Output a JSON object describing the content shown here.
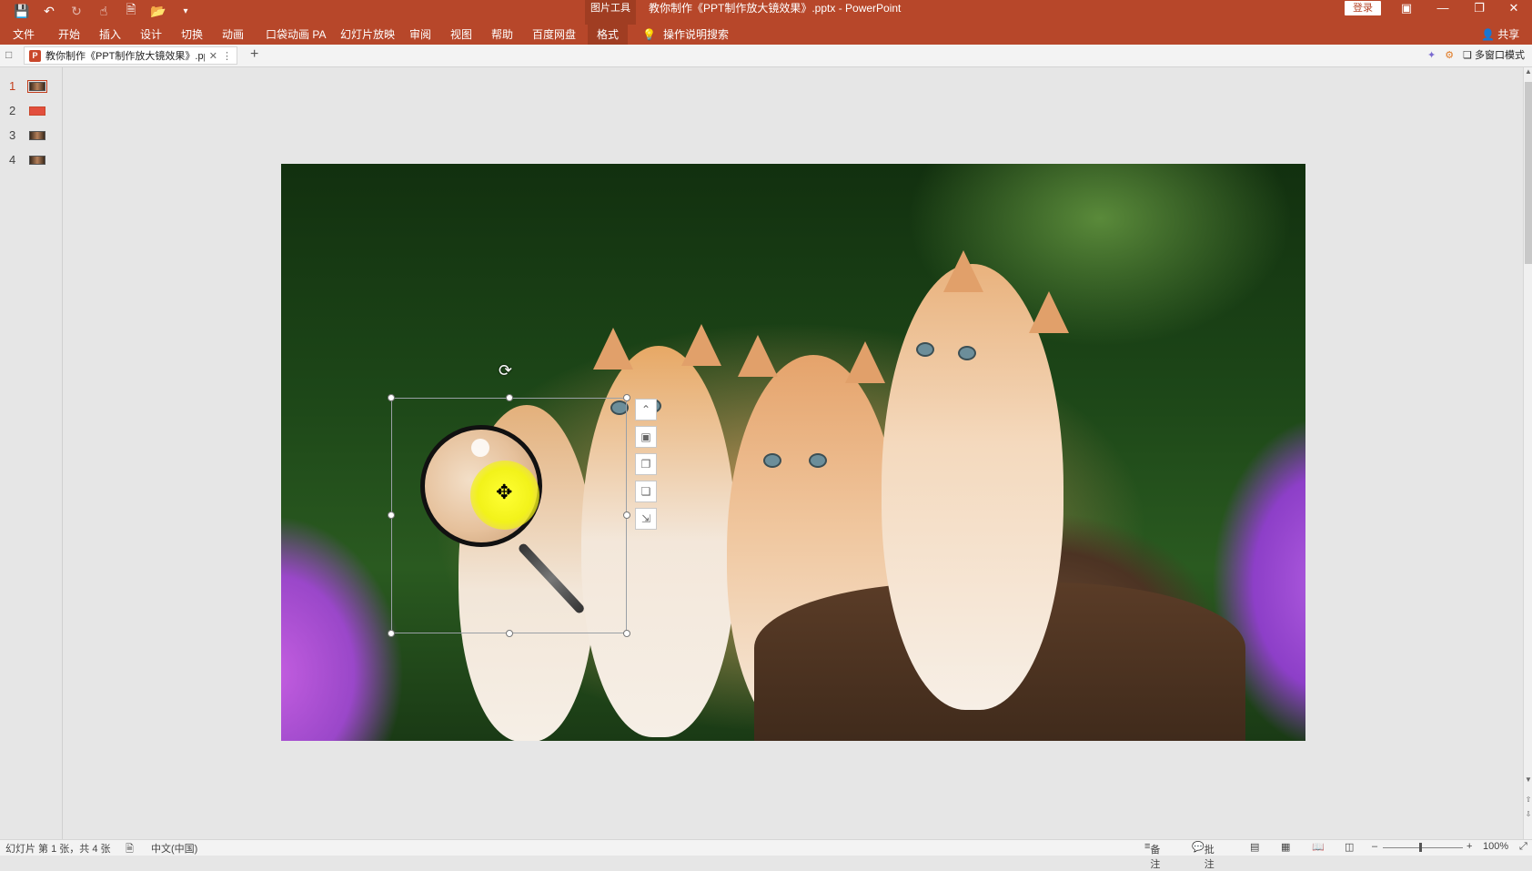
{
  "titlebar": {
    "context_tools": "图片工具",
    "doc_title": "教你制作《PPT制作放大镜效果》.pptx  -  PowerPoint",
    "login": "登录",
    "qat_icons": [
      "save-icon",
      "undo-icon",
      "redo-icon",
      "touch-icon",
      "new-file-icon",
      "open-folder-icon",
      "more-icon"
    ]
  },
  "ribbon": {
    "tabs": [
      "文件",
      "开始",
      "插入",
      "设计",
      "切换",
      "动画",
      "口袋动画 PA",
      "幻灯片放映",
      "审阅",
      "视图",
      "帮助",
      "百度网盘",
      "格式"
    ],
    "search": "操作说明搜索",
    "share": "共享"
  },
  "doctab": {
    "filename": "教你制作《PPT制作放大镜效果》.pptx",
    "multi_window": "多窗口模式"
  },
  "thumbnails": [
    {
      "num": "1"
    },
    {
      "num": "2"
    },
    {
      "num": "3"
    },
    {
      "num": "4"
    }
  ],
  "status": {
    "slide": "幻灯片 第 1 张，共 4 张",
    "language": "中文(中国)",
    "notes": "备注",
    "comments": "批注",
    "zoom": "100%"
  },
  "colors": {
    "accent": "#b7472a",
    "highlight": "#f2f21a"
  }
}
